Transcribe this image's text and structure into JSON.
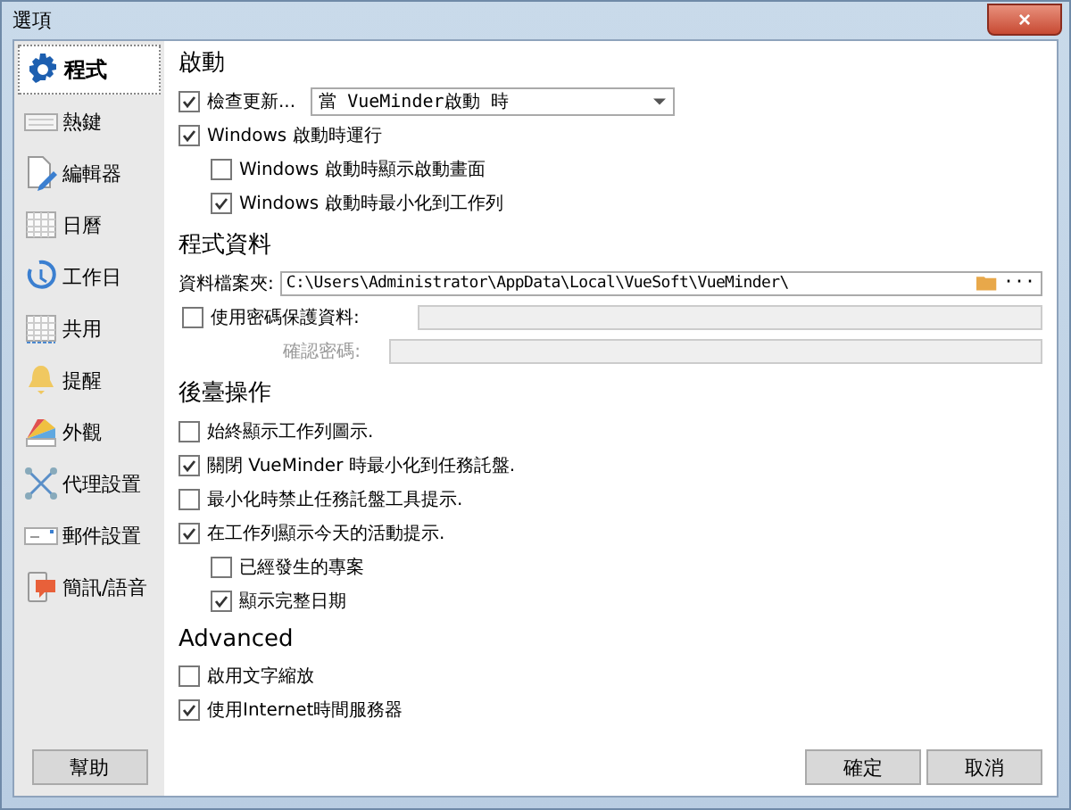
{
  "window": {
    "title": "選項",
    "close": "×"
  },
  "sidebar": {
    "items": [
      {
        "label": "程式",
        "selected": true
      },
      {
        "label": "熱鍵",
        "selected": false
      },
      {
        "label": "編輯器",
        "selected": false
      },
      {
        "label": "日曆",
        "selected": false
      },
      {
        "label": "工作日",
        "selected": false
      },
      {
        "label": "共用",
        "selected": false
      },
      {
        "label": "提醒",
        "selected": false
      },
      {
        "label": "外觀",
        "selected": false
      },
      {
        "label": "代理設置",
        "selected": false
      },
      {
        "label": "郵件設置",
        "selected": false
      },
      {
        "label": "簡訊/語音",
        "selected": false
      }
    ],
    "help_button": "幫助"
  },
  "sections": [
    {
      "title": "啟動",
      "items": [
        {
          "kind": "checkbox",
          "label": "檢查更新...",
          "checked": true,
          "dropdown": "當 VueMinder啟動 時"
        },
        {
          "kind": "checkbox",
          "label": "Windows 啟動時運行",
          "checked": true,
          "children": [
            {
              "kind": "checkbox",
              "label": "Windows 啟動時顯示啟動畫面",
              "checked": false
            },
            {
              "kind": "checkbox",
              "label": "Windows 啟動時最小化到工作列",
              "checked": true
            }
          ]
        }
      ]
    },
    {
      "title": "程式資料",
      "items": [
        {
          "kind": "path",
          "label": "資料檔案夾:",
          "value": "C:\\Users\\Administrator\\AppData\\Local\\VueSoft\\VueMinder\\",
          "more": "···"
        },
        {
          "kind": "password",
          "label": "使用密碼保護資料:",
          "checked": false
        },
        {
          "kind": "field",
          "label": "確認密碼:",
          "disabled": true
        }
      ]
    },
    {
      "title": "後臺操作",
      "items": [
        {
          "kind": "checkbox",
          "label": "始終顯示工作列圖示.",
          "checked": false
        },
        {
          "kind": "checkbox",
          "label": "關閉 VueMinder 時最小化到任務託盤.",
          "checked": true
        },
        {
          "kind": "checkbox",
          "label": "最小化時禁止任務託盤工具提示.",
          "checked": false
        },
        {
          "kind": "checkbox",
          "label": "在工作列顯示今天的活動提示.",
          "checked": true,
          "children": [
            {
              "kind": "checkbox",
              "label": "已經發生的專案",
              "checked": false
            },
            {
              "kind": "checkbox",
              "label": "顯示完整日期",
              "checked": true
            }
          ]
        }
      ]
    },
    {
      "title": "Advanced",
      "items": [
        {
          "kind": "checkbox",
          "label": "啟用文字縮放",
          "checked": false
        },
        {
          "kind": "checkbox",
          "label": "使用Internet時間服務器",
          "checked": true
        }
      ]
    }
  ],
  "buttons": [
    "確定",
    "取消"
  ]
}
